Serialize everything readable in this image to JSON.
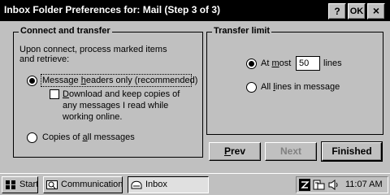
{
  "window": {
    "title": "Inbox Folder Preferences for: Mail (Step 3 of 3)",
    "help_label": "?",
    "ok_label": "OK",
    "close_label": "×"
  },
  "connect_group": {
    "legend": "Connect and transfer",
    "description_line1": "Upon connect, process marked items",
    "description_line2": "and retrieve:",
    "option_headers_pre": "Message ",
    "option_headers_u": "h",
    "option_headers_post": "eaders only (recommended)",
    "headers_selected": true,
    "download_pre": "",
    "download_u": "D",
    "download_post": "ownload and keep copies of",
    "download_line2": "any messages I read while",
    "download_line3": "working online.",
    "download_checked": false,
    "option_all_pre": "Copies of ",
    "option_all_u": "a",
    "option_all_post": "ll messages",
    "all_selected": false
  },
  "transfer_group": {
    "legend": "Transfer limit",
    "at_most_pre": "At ",
    "at_most_u": "m",
    "at_most_post": "ost",
    "at_most_selected": true,
    "lines_value": "50",
    "lines_unit": "lines",
    "all_lines_pre": "All ",
    "all_lines_u": "l",
    "all_lines_post": "ines in message",
    "all_lines_selected": false
  },
  "buttons": {
    "prev_u": "P",
    "prev_post": "rev",
    "next_label": "Next",
    "next_enabled": false,
    "finished_label": "Finished"
  },
  "taskbar": {
    "start_label": "Start",
    "communication_label": "Communication",
    "inbox_label": "Inbox",
    "clock": "11:07 AM",
    "tray_icons": [
      "network-icon",
      "pc-card-icon",
      "speaker-icon"
    ]
  }
}
